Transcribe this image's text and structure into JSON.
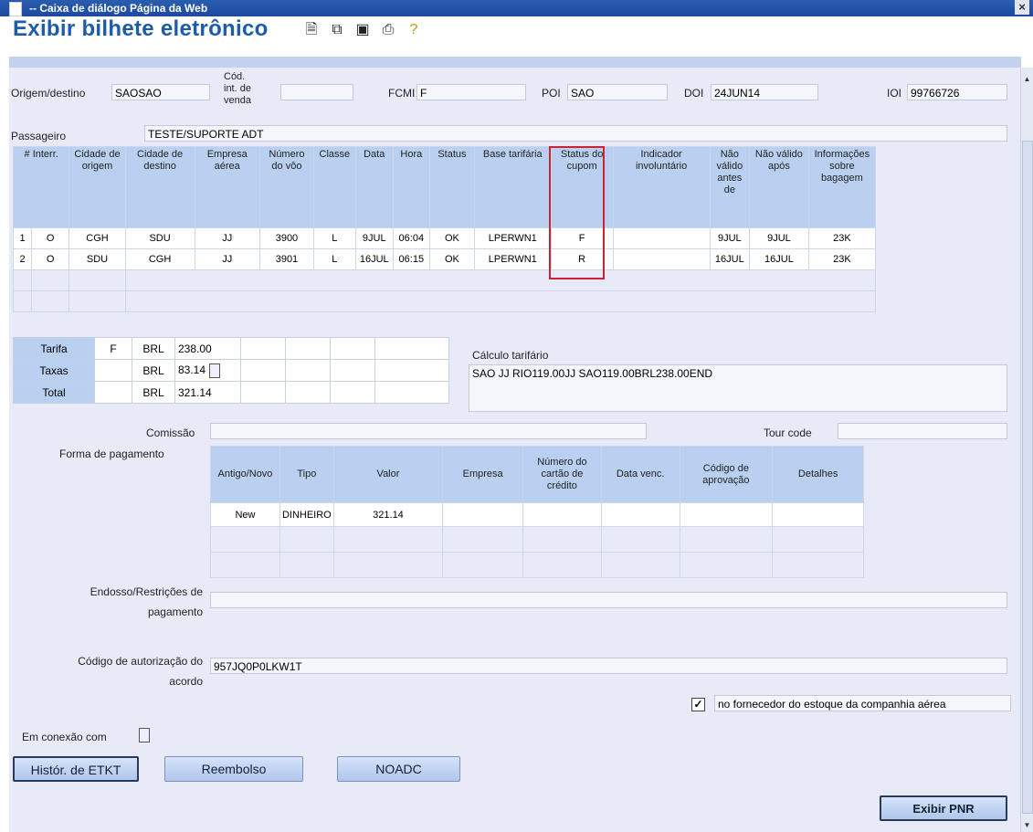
{
  "window": {
    "title": "-- Caixa de diálogo Página da Web",
    "close": "×"
  },
  "header": {
    "title": "Exibir bilhete eletrônico"
  },
  "top": {
    "origem_label": "Origem/destino",
    "origem_value": "SAOSAO",
    "cod_label1": "Cód.",
    "cod_label2": "int. de",
    "cod_label3": "venda",
    "cod_value": "",
    "fcmi_label": "FCMI",
    "fcmi_value": "F",
    "poi_label": "POI",
    "poi_value": "SAO",
    "doi_label": "DOI",
    "doi_value": "24JUN14",
    "ioi_label": "IOI",
    "ioi_value": "99766726",
    "passageiro_label": "Passageiro",
    "passageiro_value": "TESTE/SUPORTE  ADT"
  },
  "segments": {
    "headers": [
      "# Interr.",
      "Cidade de origem",
      "Cidade de destino",
      "Empresa aérea",
      "Número do vôo",
      "Classe",
      "Data",
      "Hora",
      "Status",
      "Base tarifária",
      "Status do cupom",
      "Indicador involuntário",
      "Não válido antes de",
      "Não válido após",
      "Informações sobre bagagem"
    ],
    "rows": [
      [
        "1",
        "O",
        "CGH",
        "SDU",
        "JJ",
        "3900",
        "L",
        "9JUL",
        "06:04",
        "OK",
        "LPERWN1",
        "F",
        "",
        "9JUL",
        "9JUL",
        "23K"
      ],
      [
        "2",
        "O",
        "SDU",
        "CGH",
        "JJ",
        "3901",
        "L",
        "16JUL",
        "06:15",
        "OK",
        "LPERWN1",
        "R",
        "",
        "16JUL",
        "16JUL",
        "23K"
      ]
    ]
  },
  "fare": {
    "rows": [
      {
        "label": "Tarifa",
        "code": "F",
        "currency": "BRL",
        "amount": "238.00"
      },
      {
        "label": "Taxas",
        "code": "",
        "currency": "BRL",
        "amount": "83.14"
      },
      {
        "label": "Total",
        "code": "",
        "currency": "BRL",
        "amount": "321.14"
      }
    ],
    "calc_label": "Cálculo tarifário",
    "calc_value": "SAO JJ RIO119.00JJ SAO119.00BRL238.00END"
  },
  "payment": {
    "comissao_label": "Comissão",
    "comissao_value": "",
    "tourcode_label": "Tour code",
    "tourcode_value": "",
    "forma_label": "Forma de pagamento",
    "headers": [
      "Antigo/Novo",
      "Tipo",
      "Valor",
      "Empresa",
      "Número do cartão de crédito",
      "Data venc.",
      "Código de aprovação",
      "Detalhes"
    ],
    "rows": [
      [
        "New",
        "DINHEIRO",
        "321.14",
        "",
        "",
        "",
        "",
        ""
      ]
    ]
  },
  "endosso": {
    "label1": "Endosso/Restrições de",
    "label2": "pagamento",
    "value": ""
  },
  "acordo": {
    "label1": "Código de autorização do",
    "label2": "acordo",
    "value": "957JQ0P0LKW1T"
  },
  "fornecedor": {
    "checked": "✓",
    "label": "no fornecedor do estoque da companhia aérea"
  },
  "conexao": {
    "label": "Em conexão com"
  },
  "buttons": {
    "historico": "Histór. de ETKT",
    "reembolso": "Reembolso",
    "noadc": "NOADC",
    "exibir_pnr": "Exibir PNR"
  }
}
